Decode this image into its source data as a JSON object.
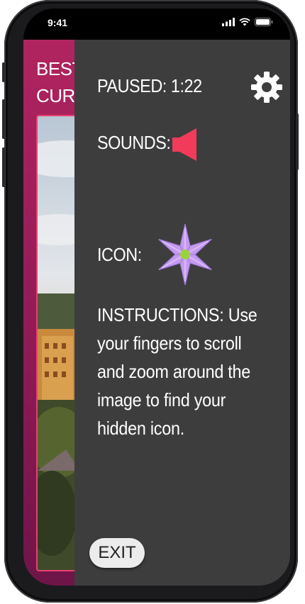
{
  "status_bar": {
    "time": "9:41"
  },
  "game": {
    "title_line1": "BEST",
    "title_line2": "CURR"
  },
  "panel": {
    "paused_label": "PAUSED: 1:22",
    "sounds_label": "SOUNDS:",
    "icon_label": "ICON:",
    "instructions": "INSTRUCTIONS: Use your fingers to scroll and zoom around the image to find your hidden icon.",
    "exit_label": "EXIT"
  },
  "colors": {
    "accent": "#f23b5a",
    "panel_bg": "#3d3d3d",
    "flower_petal": "#c59bf0",
    "flower_center": "#9bd13c",
    "game_bg": "#a11f5b"
  },
  "icons": {
    "settings": "gear-icon",
    "sound": "speaker-icon",
    "hidden": "flower-icon"
  }
}
